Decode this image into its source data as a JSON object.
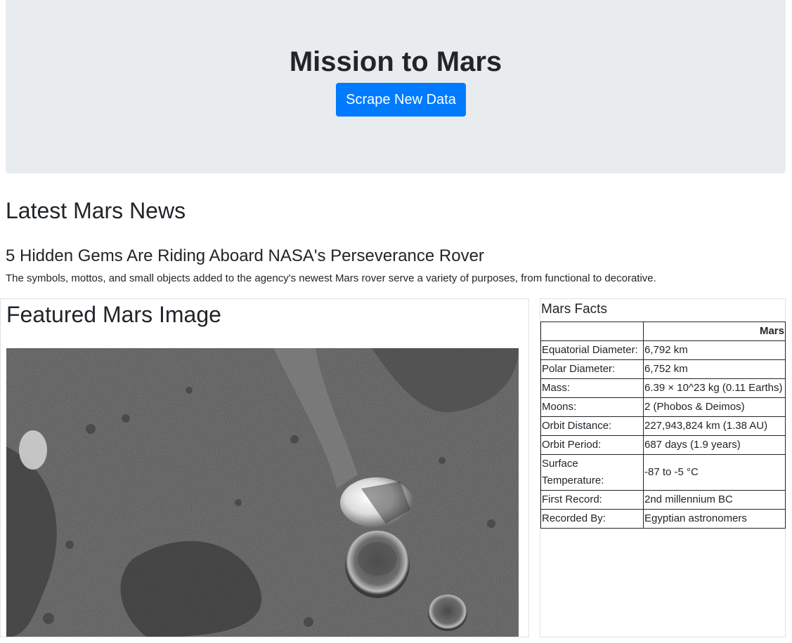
{
  "header": {
    "title": "Mission to Mars",
    "scrape_button": "Scrape New Data"
  },
  "news": {
    "section_heading": "Latest Mars News",
    "title": "5 Hidden Gems Are Riding Aboard NASA's Perseverance Rover",
    "teaser": "The symbols, mottos, and small objects added to the agency's newest Mars rover serve a variety of purposes, from functional to decorative."
  },
  "featured_image": {
    "heading": "Featured Mars Image"
  },
  "facts": {
    "heading": "Mars Facts",
    "columns": [
      "",
      "Mars"
    ],
    "rows": [
      {
        "label": "Equatorial Diameter:",
        "value": "6,792 km"
      },
      {
        "label": "Polar Diameter:",
        "value": "6,752 km"
      },
      {
        "label": "Mass:",
        "value": "6.39 × 10^23 kg (0.11 Earths)"
      },
      {
        "label": "Moons:",
        "value": "2 (Phobos & Deimos)"
      },
      {
        "label": "Orbit Distance:",
        "value": "227,943,824 km (1.38 AU)"
      },
      {
        "label": "Orbit Period:",
        "value": "687 days (1.9 years)"
      },
      {
        "label": "Surface Temperature:",
        "value": "-87 to -5 °C"
      },
      {
        "label": "First Record:",
        "value": "2nd millennium BC"
      },
      {
        "label": "Recorded By:",
        "value": "Egyptian astronomers"
      }
    ]
  }
}
